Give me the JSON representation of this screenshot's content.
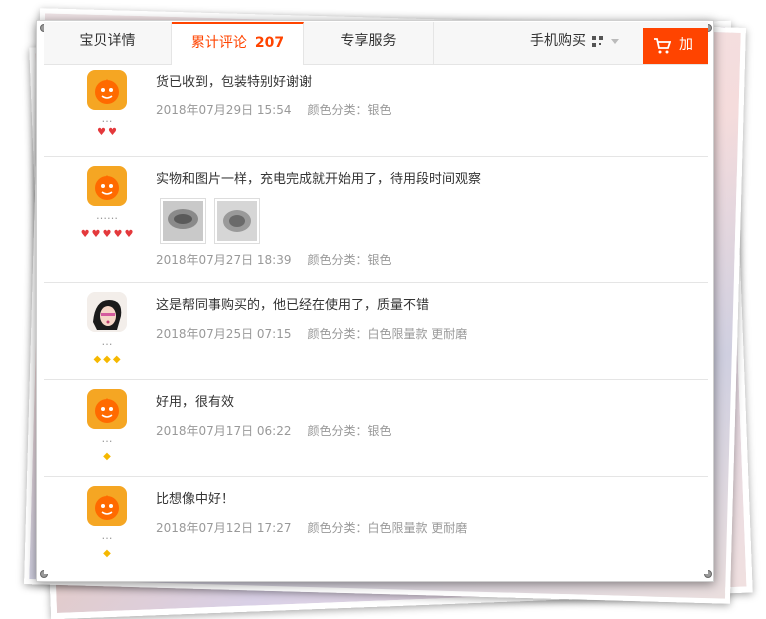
{
  "tabs": [
    {
      "label": "宝贝详情"
    },
    {
      "label": "累计评论",
      "count": "207"
    },
    {
      "label": "专享服务"
    }
  ],
  "mobile_buy": "手机购买",
  "cart_label": "加",
  "colors": {
    "accent": "#ff4400",
    "meta": "#999999",
    "text": "#333333"
  },
  "reviews": [
    {
      "user": "…",
      "rank_icon": "heart",
      "rank_count": 2,
      "avatar": "orange-mascot",
      "text": "货已收到，包装特别好谢谢",
      "date": "2018年07月29日 15:54",
      "sku": "颜色分类：银色"
    },
    {
      "user": "……",
      "rank_icon": "heart",
      "rank_count": 5,
      "avatar": "orange-mascot",
      "text": "实物和图片一样，充电完成就开始用了，待用段时间观察",
      "photos": [
        "product-photo-1",
        "product-photo-2"
      ],
      "date": "2018年07月27日 18:39",
      "sku": "颜色分类：银色"
    },
    {
      "user": "…",
      "rank_icon": "diamond",
      "rank_count": 3,
      "avatar": "woman-portrait",
      "text": "这是帮同事购买的，他已经在使用了，质量不错",
      "date": "2018年07月25日 07:15",
      "sku": "颜色分类：白色限量款 更耐磨"
    },
    {
      "user": "…",
      "rank_icon": "diamond",
      "rank_count": 1,
      "avatar": "orange-mascot",
      "text": "好用，很有效",
      "date": "2018年07月17日 06:22",
      "sku": "颜色分类：银色"
    },
    {
      "user": "…",
      "rank_icon": "diamond",
      "rank_count": 1,
      "avatar": "orange-mascot",
      "text": "比想像中好！",
      "date": "2018年07月12日 17:27",
      "sku": "颜色分类：白色限量款 更耐磨"
    }
  ]
}
